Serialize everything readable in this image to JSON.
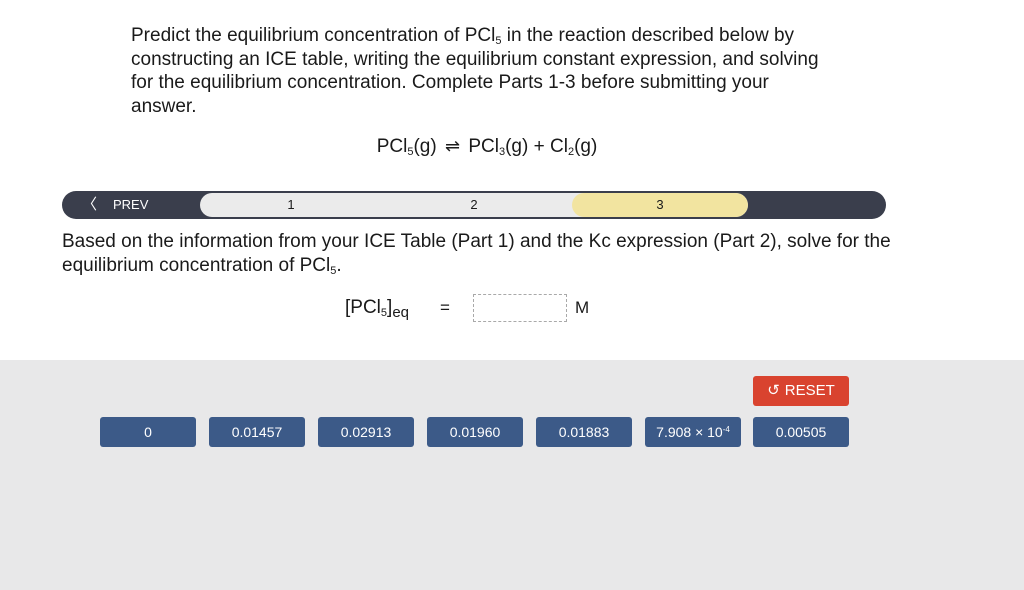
{
  "prompt": {
    "p1": "Predict the equilibrium concentration of PCl",
    "p1_sub": "5",
    "p2": " in the reaction described below by constructing an ICE table, writing the equilibrium constant expression, and solving for the equilibrium concentration. Complete Parts 1-3 before submitting your answer."
  },
  "reaction": {
    "r1": "PCl",
    "r1_sub": "5",
    "r1_state": "(g)",
    "arrow": "⇌",
    "p1": "PCl",
    "p1_sub": "3",
    "p1_state": "(g)",
    "plus": "+",
    "p2": "Cl",
    "p2_sub": "2",
    "p2_state": "(g)"
  },
  "stepper": {
    "prev_label": "PREV",
    "prev_icon": "chevron-left-icon",
    "steps": [
      "1",
      "2",
      "3"
    ],
    "active_step": "3",
    "active_color": "#f2e4a0"
  },
  "question": {
    "q1": "Based on the information from your ICE Table (Part 1) and the  Kc expression (Part 2), solve for the equilibrium concentration of PCl",
    "q1_sub": "5",
    "q1_end": "."
  },
  "answer": {
    "lhs_open": "[PCl",
    "lhs_sub": "5",
    "lhs_close": "]",
    "lhs_eq": "eq",
    "equals": "=",
    "value": "",
    "unit": "M"
  },
  "tray": {
    "reset_label": "RESET",
    "reset_icon": "undo-icon",
    "reset_color": "#d9432f",
    "tile_color": "#3c5a88",
    "tiles": [
      "0",
      "0.01457",
      "0.02913",
      "0.01960",
      "0.01883",
      "7.908 × 10",
      "0.00505"
    ],
    "tile_exponent": "-4"
  }
}
